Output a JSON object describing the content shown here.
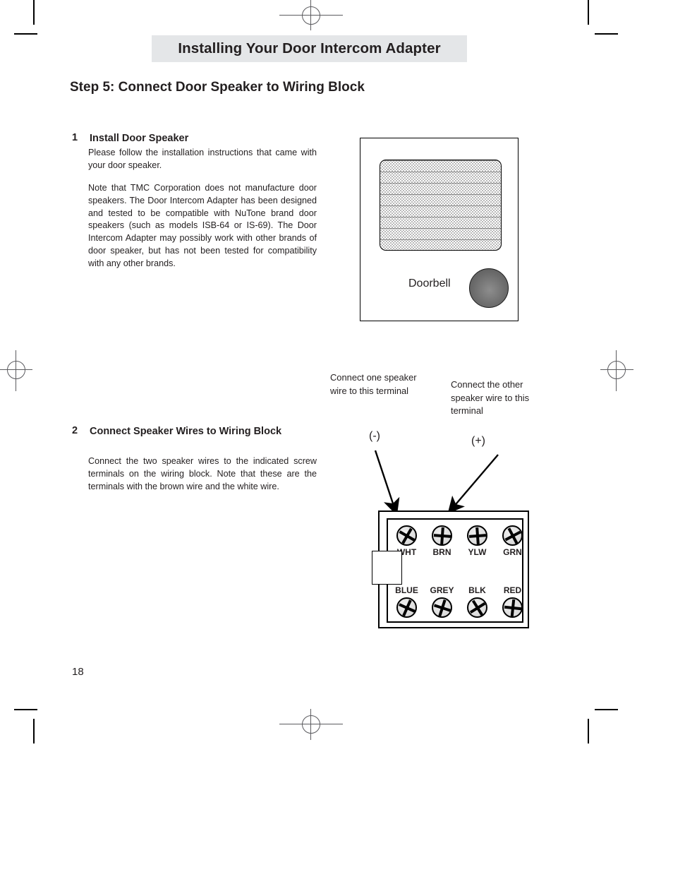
{
  "page": {
    "running_header": "Installing Your Door Intercom Adapter",
    "step_title": "Step 5: Connect Door Speaker to Wiring Block",
    "page_number": "18",
    "colors": {
      "banner_background": "#e4e6e8",
      "text": "#231f20",
      "line": "#000000",
      "screw_face": "#e2e2e2",
      "doorbell_button": "#6b6b6b"
    }
  },
  "steps": [
    {
      "number": "1",
      "heading": "Install Door Speaker",
      "paragraphs": [
        "Please follow the installation instructions that came with your door speaker.",
        "Note that TMC Corporation does not manufacture door speakers.  The Door Intercom Adapter has been designed and tested to be compatible with NuTone brand door speakers (such as models ISB-64 or IS-69).  The Door Intercom Adapter may possibly work with other brands of door speaker, but has not been tested for compatibility with any other brands."
      ]
    },
    {
      "number": "2",
      "heading": "Connect Speaker Wires to Wiring Block",
      "paragraphs": [
        "Connect the two speaker wires to the indicated screw terminals on the wiring block.  Note that these are the terminals with the brown wire and the white wire."
      ]
    }
  ],
  "door_speaker_figure": {
    "doorbell_label": "Doorbell",
    "button_name": "doorbell-push-button",
    "grille_name": "speaker-grille"
  },
  "wiring_figure": {
    "callouts": [
      {
        "id": "left",
        "text": "Connect one speaker wire to this terminal"
      },
      {
        "id": "right",
        "text": "Connect the other speaker wire to this terminal"
      }
    ],
    "polarity": [
      {
        "id": "negative",
        "label": "(-)"
      },
      {
        "id": "positive",
        "label": "(+)"
      }
    ],
    "terminals_top": [
      {
        "label": "WHT",
        "slot": "x"
      },
      {
        "label": "BRN",
        "slot": "plus"
      },
      {
        "label": "YLW",
        "slot": "plus"
      },
      {
        "label": "GRN",
        "slot": "x"
      }
    ],
    "terminals_bottom": [
      {
        "label": "BLUE",
        "slot": "x"
      },
      {
        "label": "GREY",
        "slot": "x"
      },
      {
        "label": "BLK",
        "slot": "x"
      },
      {
        "label": "RED",
        "slot": "plus"
      }
    ]
  }
}
